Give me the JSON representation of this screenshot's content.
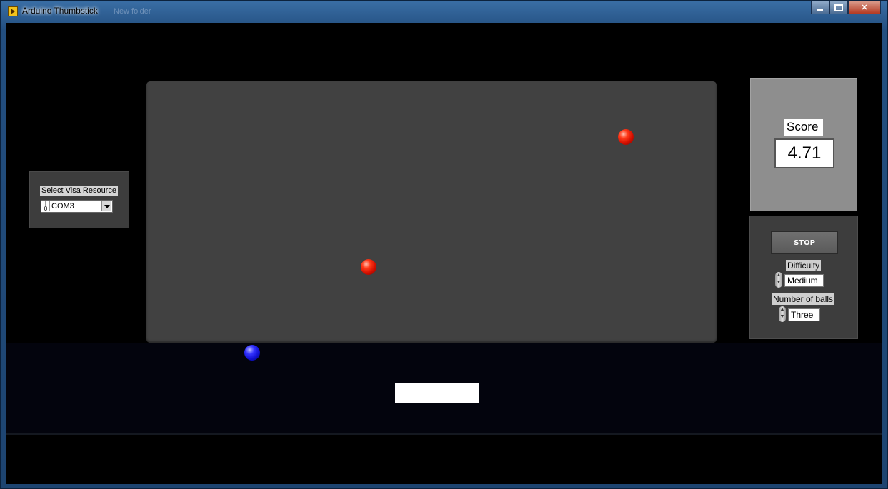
{
  "window": {
    "title": "Arduino Thumbstick",
    "background_text": "New folder"
  },
  "visa": {
    "label": "Select Visa Resource",
    "io_glyph": "I/O",
    "value": "COM3"
  },
  "game": {
    "balls": [
      {
        "color": "red"
      },
      {
        "color": "red"
      },
      {
        "color": "blue"
      }
    ]
  },
  "score": {
    "label": "Score",
    "value": "4.71"
  },
  "controls": {
    "stop_label": "STOP",
    "difficulty_label": "Difficulty",
    "difficulty_value": "Medium",
    "balls_label": "Number of balls",
    "balls_value": "Three"
  },
  "colors": {
    "ball_red": "#e81e05",
    "ball_blue": "#2020f0",
    "game_area": "#414141"
  },
  "icons": {
    "app": "labview-vi-icon",
    "minimize": "minimize-icon",
    "maximize": "maximize-icon",
    "close": "close-icon"
  }
}
